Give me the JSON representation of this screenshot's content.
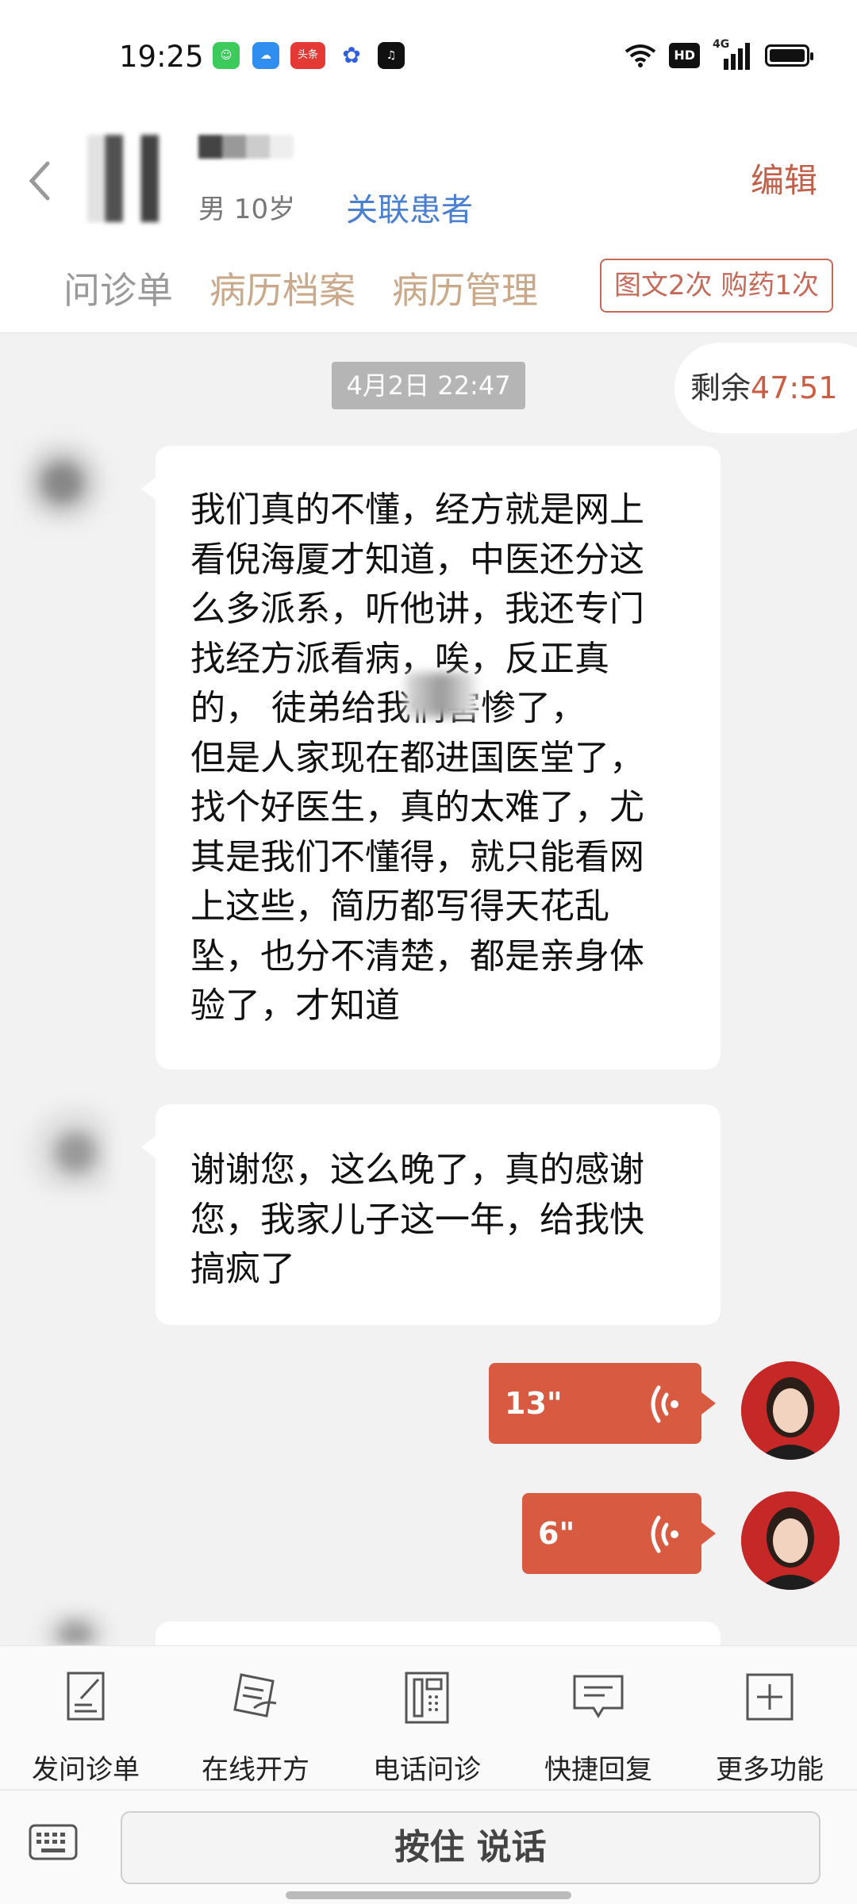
{
  "status_bar": {
    "time": "19:25",
    "app_icons": [
      {
        "name": "message-app-icon",
        "color": "#3ccb5a"
      },
      {
        "name": "cloud-app-icon",
        "color": "#2f8ef0"
      },
      {
        "name": "toutiao-app-icon",
        "color": "#e53935",
        "text": "头条"
      },
      {
        "name": "baidu-app-icon",
        "color": "#2f5fe0"
      },
      {
        "name": "tiktok-app-icon",
        "color": "#111111"
      }
    ],
    "hd": "HD",
    "network": "4G"
  },
  "header": {
    "patient_info": "男 10岁",
    "link_patient": "关联患者",
    "edit": "编辑",
    "tabs": [
      "问诊单",
      "病历档案",
      "病历管理"
    ],
    "badge": "图文2次 购药1次"
  },
  "chat": {
    "timestamp": "4月2日 22:47",
    "timer_label": "剩余",
    "timer_value": "47:51",
    "messages": [
      {
        "text": "我们真的不懂，经方就是网上\n看倪海厦才知道，中医还分这\n么多派系，听他讲，我还专门\n找经方派看病，唉，反正真\n的，     徒弟给我们害惨了，\n但是人家现在都进国医堂了，\n找个好医生，真的太难了，尤\n其是我们不懂得，就只能看网\n上这些，简历都写得天花乱\n坠，也分不清楚，都是亲身体\n验了，才知道"
      },
      {
        "text": "谢谢您，这么晚了，真的感谢\n您，我家儿子这一年，给我快\n搞疯了"
      }
    ],
    "voice_messages": [
      {
        "duration": "13\""
      },
      {
        "duration": "6\""
      }
    ]
  },
  "toolbar": {
    "items": [
      {
        "label": "发问诊单",
        "icon": "form-icon"
      },
      {
        "label": "在线开方",
        "icon": "prescription-icon"
      },
      {
        "label": "电话问诊",
        "icon": "phone-icon"
      },
      {
        "label": "快捷回复",
        "icon": "quick-reply-icon"
      },
      {
        "label": "更多功能",
        "icon": "plus-icon"
      }
    ]
  },
  "input": {
    "talk_label": "按住 说话"
  },
  "colors": {
    "accent": "#d85a40",
    "tab": "#c9a989",
    "link": "#4a7fd0"
  }
}
